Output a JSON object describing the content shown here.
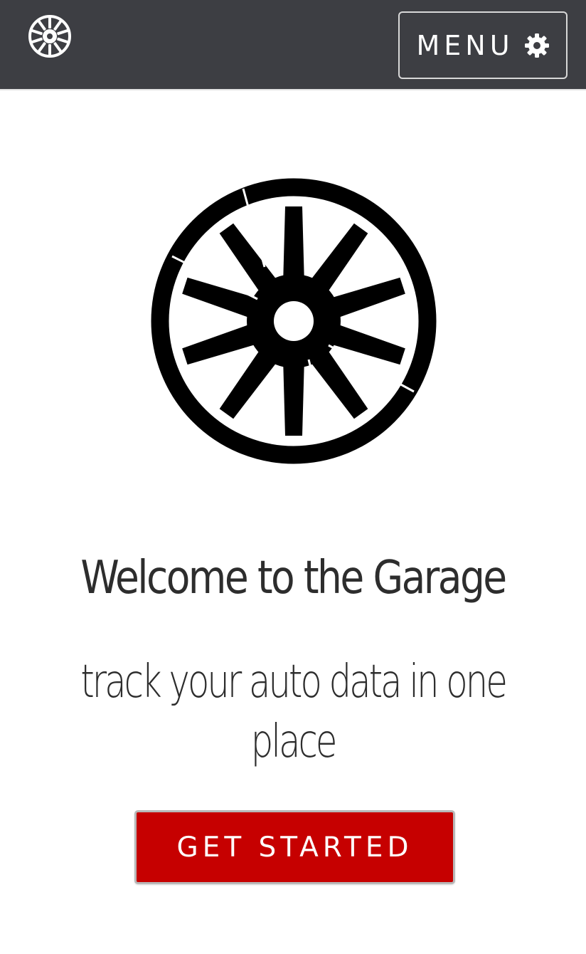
{
  "navbar": {
    "logo_icon": "wheel-icon",
    "menu_label": "MENU",
    "menu_icon": "gear-icon",
    "background_color": "#3d3e43"
  },
  "hero": {
    "image_icon": "wheel-icon",
    "title": "Welcome to the Garage",
    "subtitle": "track your auto data in one place"
  },
  "cta": {
    "label": "GET STARTED",
    "color": "#c60000"
  }
}
